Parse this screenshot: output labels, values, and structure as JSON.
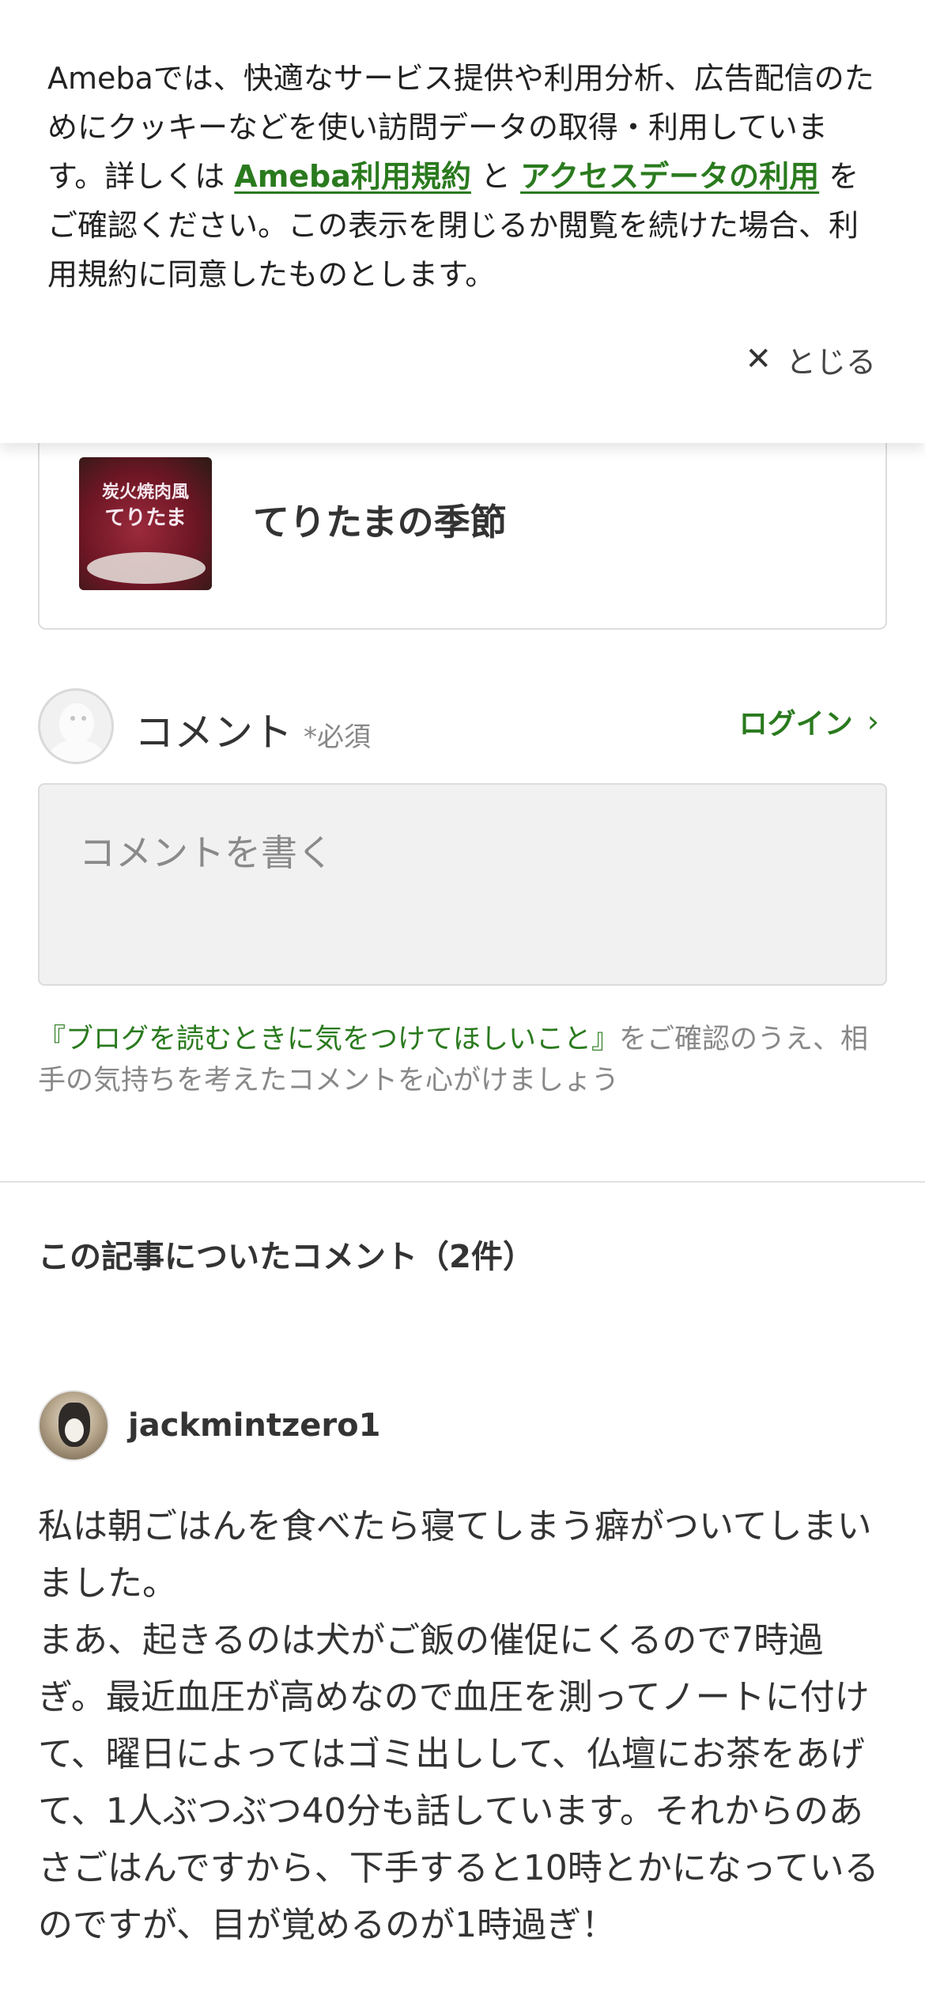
{
  "cookie_banner": {
    "text_before": "Amebaでは、快適なサービス提供や利用分析、広告配信のためにクッキーなどを使い訪問データの取得・利用しています。詳しくは ",
    "terms_link": "Ameba利用規約",
    "text_mid": " と ",
    "access_link": "アクセスデータの利用",
    "text_after": " をご確認ください。この表示を閉じるか閲覧を続けた場合、利用規約に同意したものとします。",
    "close_label": "とじる"
  },
  "blog_card": {
    "title": "てりたまの季節",
    "thumbnail_text_1": "炭火焼肉風",
    "thumbnail_text_2": "てりたま"
  },
  "comment_form": {
    "label": "コメント",
    "required": "*必須",
    "login": "ログイン",
    "placeholder": "コメントを書く",
    "guide_link": "『ブログを読むときに気をつけてほしいこと』",
    "guide_text": "をご確認のうえ、相手の気持ちを考えたコメントを心がけましょう"
  },
  "comments": {
    "title": "この記事についたコメント（2件）",
    "items": [
      {
        "username": "jackmintzero1",
        "text": "私は朝ごはんを食べたら寝てしまう癖がついてしまいました。\nまあ、起きるのは犬がご飯の催促にくるので7時過ぎ。最近血圧が高めなので血圧を測ってノートに付けて、曜日によってはゴミ出しして、仏壇にお茶をあげて、1人ぶつぶつ40分も話しています。それからのあさごはんですから、下手すると10時とかになっているのですが、目が覚めるのが1時過ぎ！"
      }
    ]
  },
  "colors": {
    "accent_green": "#2a7a1e",
    "text": "#333333",
    "muted": "#888888"
  }
}
